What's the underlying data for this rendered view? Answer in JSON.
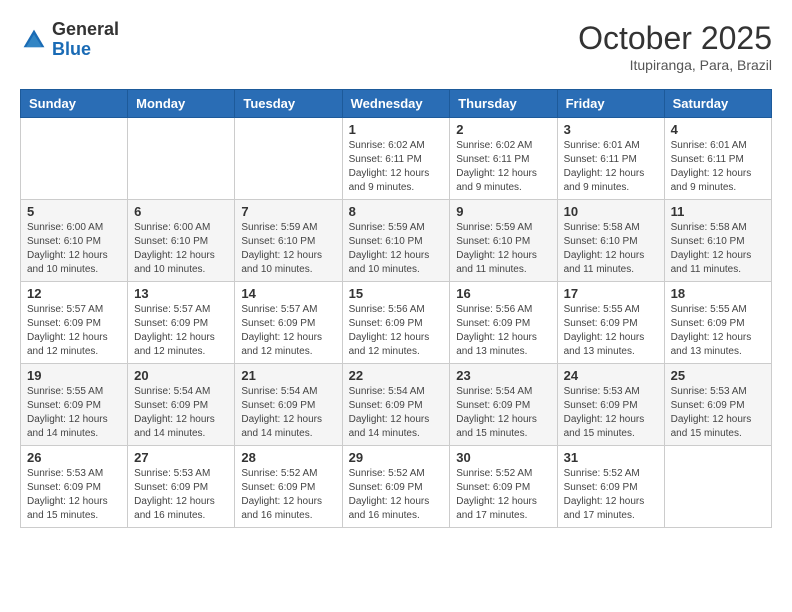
{
  "header": {
    "logo": {
      "general": "General",
      "blue": "Blue"
    },
    "title": "October 2025",
    "location": "Itupiranga, Para, Brazil"
  },
  "weekdays": [
    "Sunday",
    "Monday",
    "Tuesday",
    "Wednesday",
    "Thursday",
    "Friday",
    "Saturday"
  ],
  "weeks": [
    [
      {
        "day": "",
        "sunrise": "",
        "sunset": "",
        "daylight": ""
      },
      {
        "day": "",
        "sunrise": "",
        "sunset": "",
        "daylight": ""
      },
      {
        "day": "",
        "sunrise": "",
        "sunset": "",
        "daylight": ""
      },
      {
        "day": "1",
        "sunrise": "Sunrise: 6:02 AM",
        "sunset": "Sunset: 6:11 PM",
        "daylight": "Daylight: 12 hours and 9 minutes."
      },
      {
        "day": "2",
        "sunrise": "Sunrise: 6:02 AM",
        "sunset": "Sunset: 6:11 PM",
        "daylight": "Daylight: 12 hours and 9 minutes."
      },
      {
        "day": "3",
        "sunrise": "Sunrise: 6:01 AM",
        "sunset": "Sunset: 6:11 PM",
        "daylight": "Daylight: 12 hours and 9 minutes."
      },
      {
        "day": "4",
        "sunrise": "Sunrise: 6:01 AM",
        "sunset": "Sunset: 6:11 PM",
        "daylight": "Daylight: 12 hours and 9 minutes."
      }
    ],
    [
      {
        "day": "5",
        "sunrise": "Sunrise: 6:00 AM",
        "sunset": "Sunset: 6:10 PM",
        "daylight": "Daylight: 12 hours and 10 minutes."
      },
      {
        "day": "6",
        "sunrise": "Sunrise: 6:00 AM",
        "sunset": "Sunset: 6:10 PM",
        "daylight": "Daylight: 12 hours and 10 minutes."
      },
      {
        "day": "7",
        "sunrise": "Sunrise: 5:59 AM",
        "sunset": "Sunset: 6:10 PM",
        "daylight": "Daylight: 12 hours and 10 minutes."
      },
      {
        "day": "8",
        "sunrise": "Sunrise: 5:59 AM",
        "sunset": "Sunset: 6:10 PM",
        "daylight": "Daylight: 12 hours and 10 minutes."
      },
      {
        "day": "9",
        "sunrise": "Sunrise: 5:59 AM",
        "sunset": "Sunset: 6:10 PM",
        "daylight": "Daylight: 12 hours and 11 minutes."
      },
      {
        "day": "10",
        "sunrise": "Sunrise: 5:58 AM",
        "sunset": "Sunset: 6:10 PM",
        "daylight": "Daylight: 12 hours and 11 minutes."
      },
      {
        "day": "11",
        "sunrise": "Sunrise: 5:58 AM",
        "sunset": "Sunset: 6:10 PM",
        "daylight": "Daylight: 12 hours and 11 minutes."
      }
    ],
    [
      {
        "day": "12",
        "sunrise": "Sunrise: 5:57 AM",
        "sunset": "Sunset: 6:09 PM",
        "daylight": "Daylight: 12 hours and 12 minutes."
      },
      {
        "day": "13",
        "sunrise": "Sunrise: 5:57 AM",
        "sunset": "Sunset: 6:09 PM",
        "daylight": "Daylight: 12 hours and 12 minutes."
      },
      {
        "day": "14",
        "sunrise": "Sunrise: 5:57 AM",
        "sunset": "Sunset: 6:09 PM",
        "daylight": "Daylight: 12 hours and 12 minutes."
      },
      {
        "day": "15",
        "sunrise": "Sunrise: 5:56 AM",
        "sunset": "Sunset: 6:09 PM",
        "daylight": "Daylight: 12 hours and 12 minutes."
      },
      {
        "day": "16",
        "sunrise": "Sunrise: 5:56 AM",
        "sunset": "Sunset: 6:09 PM",
        "daylight": "Daylight: 12 hours and 13 minutes."
      },
      {
        "day": "17",
        "sunrise": "Sunrise: 5:55 AM",
        "sunset": "Sunset: 6:09 PM",
        "daylight": "Daylight: 12 hours and 13 minutes."
      },
      {
        "day": "18",
        "sunrise": "Sunrise: 5:55 AM",
        "sunset": "Sunset: 6:09 PM",
        "daylight": "Daylight: 12 hours and 13 minutes."
      }
    ],
    [
      {
        "day": "19",
        "sunrise": "Sunrise: 5:55 AM",
        "sunset": "Sunset: 6:09 PM",
        "daylight": "Daylight: 12 hours and 14 minutes."
      },
      {
        "day": "20",
        "sunrise": "Sunrise: 5:54 AM",
        "sunset": "Sunset: 6:09 PM",
        "daylight": "Daylight: 12 hours and 14 minutes."
      },
      {
        "day": "21",
        "sunrise": "Sunrise: 5:54 AM",
        "sunset": "Sunset: 6:09 PM",
        "daylight": "Daylight: 12 hours and 14 minutes."
      },
      {
        "day": "22",
        "sunrise": "Sunrise: 5:54 AM",
        "sunset": "Sunset: 6:09 PM",
        "daylight": "Daylight: 12 hours and 14 minutes."
      },
      {
        "day": "23",
        "sunrise": "Sunrise: 5:54 AM",
        "sunset": "Sunset: 6:09 PM",
        "daylight": "Daylight: 12 hours and 15 minutes."
      },
      {
        "day": "24",
        "sunrise": "Sunrise: 5:53 AM",
        "sunset": "Sunset: 6:09 PM",
        "daylight": "Daylight: 12 hours and 15 minutes."
      },
      {
        "day": "25",
        "sunrise": "Sunrise: 5:53 AM",
        "sunset": "Sunset: 6:09 PM",
        "daylight": "Daylight: 12 hours and 15 minutes."
      }
    ],
    [
      {
        "day": "26",
        "sunrise": "Sunrise: 5:53 AM",
        "sunset": "Sunset: 6:09 PM",
        "daylight": "Daylight: 12 hours and 15 minutes."
      },
      {
        "day": "27",
        "sunrise": "Sunrise: 5:53 AM",
        "sunset": "Sunset: 6:09 PM",
        "daylight": "Daylight: 12 hours and 16 minutes."
      },
      {
        "day": "28",
        "sunrise": "Sunrise: 5:52 AM",
        "sunset": "Sunset: 6:09 PM",
        "daylight": "Daylight: 12 hours and 16 minutes."
      },
      {
        "day": "29",
        "sunrise": "Sunrise: 5:52 AM",
        "sunset": "Sunset: 6:09 PM",
        "daylight": "Daylight: 12 hours and 16 minutes."
      },
      {
        "day": "30",
        "sunrise": "Sunrise: 5:52 AM",
        "sunset": "Sunset: 6:09 PM",
        "daylight": "Daylight: 12 hours and 17 minutes."
      },
      {
        "day": "31",
        "sunrise": "Sunrise: 5:52 AM",
        "sunset": "Sunset: 6:09 PM",
        "daylight": "Daylight: 12 hours and 17 minutes."
      },
      {
        "day": "",
        "sunrise": "",
        "sunset": "",
        "daylight": ""
      }
    ]
  ]
}
